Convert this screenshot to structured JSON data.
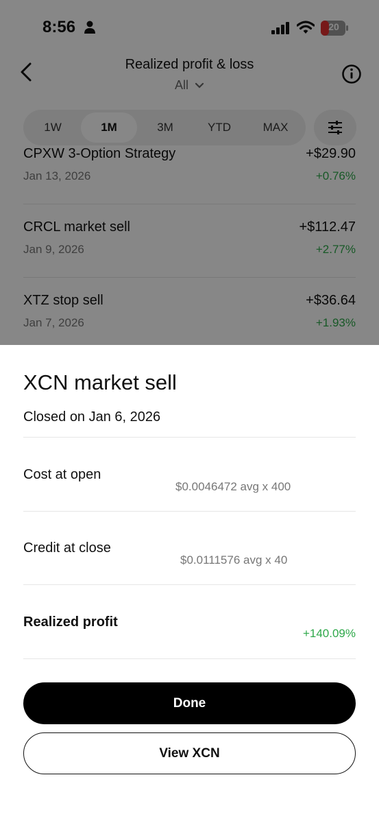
{
  "status_bar": {
    "time": "8:56",
    "battery": "20"
  },
  "header": {
    "title": "Realized profit & loss",
    "filter": "All"
  },
  "periods": [
    "1W",
    "1M",
    "3M",
    "YTD",
    "MAX"
  ],
  "selected_period": "1M",
  "transactions": [
    {
      "name": "CPXW 3-Option Strategy",
      "date": "Jan 13, 2026",
      "amount": "+$29.90",
      "pct": "+0.76%"
    },
    {
      "name": "CRCL market sell",
      "date": "Jan 9, 2026",
      "amount": "+$112.47",
      "pct": "+2.77%"
    },
    {
      "name": "XTZ stop sell",
      "date": "Jan 7, 2026",
      "amount": "+$36.64",
      "pct": "+1.93%"
    }
  ],
  "sheet": {
    "title": "XCN market sell",
    "subtitle": "Closed on Jan 6, 2026",
    "cost_label": "Cost at open",
    "cost_detail": "$0.0046472 avg x 400",
    "credit_label": "Credit at close",
    "credit_detail": "$0.0111576 avg x 40",
    "profit_label": "Realized profit",
    "profit_pct": "+140.09%",
    "done_label": "Done",
    "view_label": "View XCN"
  },
  "colors": {
    "gain": "#2ea84a",
    "primary_button": "#000000"
  }
}
